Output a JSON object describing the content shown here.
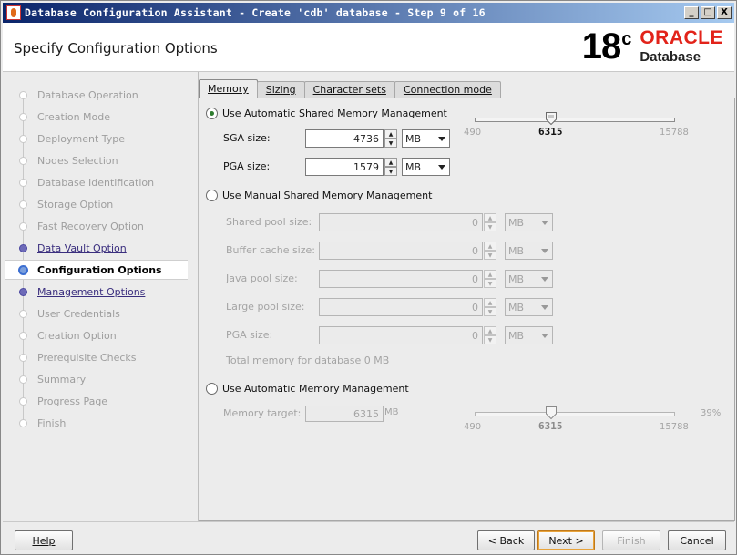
{
  "window": {
    "title": "Database Configuration Assistant - Create 'cdb' database - Step 9 of 16",
    "controls": [
      "_",
      "□",
      "X"
    ]
  },
  "header": {
    "page_title": "Specify Configuration Options",
    "logo_version": "18",
    "logo_version_sup": "c",
    "logo_brand": "ORACLE",
    "logo_product": "Database"
  },
  "sidebar": {
    "steps": [
      {
        "label": "Database Operation",
        "state": "done"
      },
      {
        "label": "Creation Mode",
        "state": "done"
      },
      {
        "label": "Deployment Type",
        "state": "done"
      },
      {
        "label": "Nodes Selection",
        "state": "done"
      },
      {
        "label": "Database Identification",
        "state": "done"
      },
      {
        "label": "Storage Option",
        "state": "done"
      },
      {
        "label": "Fast Recovery Option",
        "state": "done"
      },
      {
        "label": "Data Vault Option",
        "state": "link"
      },
      {
        "label": "Configuration Options",
        "state": "current"
      },
      {
        "label": "Management Options",
        "state": "link"
      },
      {
        "label": "User Credentials",
        "state": "todo"
      },
      {
        "label": "Creation Option",
        "state": "todo"
      },
      {
        "label": "Prerequisite Checks",
        "state": "todo"
      },
      {
        "label": "Summary",
        "state": "todo"
      },
      {
        "label": "Progress Page",
        "state": "todo"
      },
      {
        "label": "Finish",
        "state": "todo"
      }
    ]
  },
  "tabs": [
    {
      "label": "Memory",
      "active": true
    },
    {
      "label": "Sizing",
      "active": false
    },
    {
      "label": "Character sets",
      "active": false
    },
    {
      "label": "Connection mode",
      "active": false
    }
  ],
  "memory": {
    "asmm": {
      "label": "Use Automatic Shared Memory Management",
      "selected": true,
      "sga_label": "SGA size:",
      "sga_value": "4736",
      "sga_unit": "MB",
      "pga_label": "PGA size:",
      "pga_value": "1579",
      "pga_unit": "MB",
      "slider_min": "490",
      "slider_value": "6315",
      "slider_max": "15788",
      "slider_fraction": 0.38
    },
    "manual": {
      "label": "Use Manual Shared Memory Management",
      "selected": false,
      "fields": [
        {
          "label": "Shared pool size:",
          "value": "0",
          "unit": "MB"
        },
        {
          "label": "Buffer cache size:",
          "value": "0",
          "unit": "MB"
        },
        {
          "label": "Java pool size:",
          "value": "0",
          "unit": "MB"
        },
        {
          "label": "Large pool size:",
          "value": "0",
          "unit": "MB"
        },
        {
          "label": "PGA size:",
          "value": "0",
          "unit": "MB"
        }
      ],
      "total_text": "Total memory for database 0 MB"
    },
    "amm": {
      "label": "Use Automatic Memory Management",
      "selected": false,
      "target_label": "Memory target:",
      "target_value": "6315",
      "target_unit": "MB",
      "percent": "39%",
      "slider_min": "490",
      "slider_value": "6315",
      "slider_max": "15788",
      "slider_fraction": 0.38
    }
  },
  "buttons": {
    "help": "Help",
    "back": "< Back",
    "next": "Next >",
    "finish": "Finish",
    "cancel": "Cancel"
  }
}
